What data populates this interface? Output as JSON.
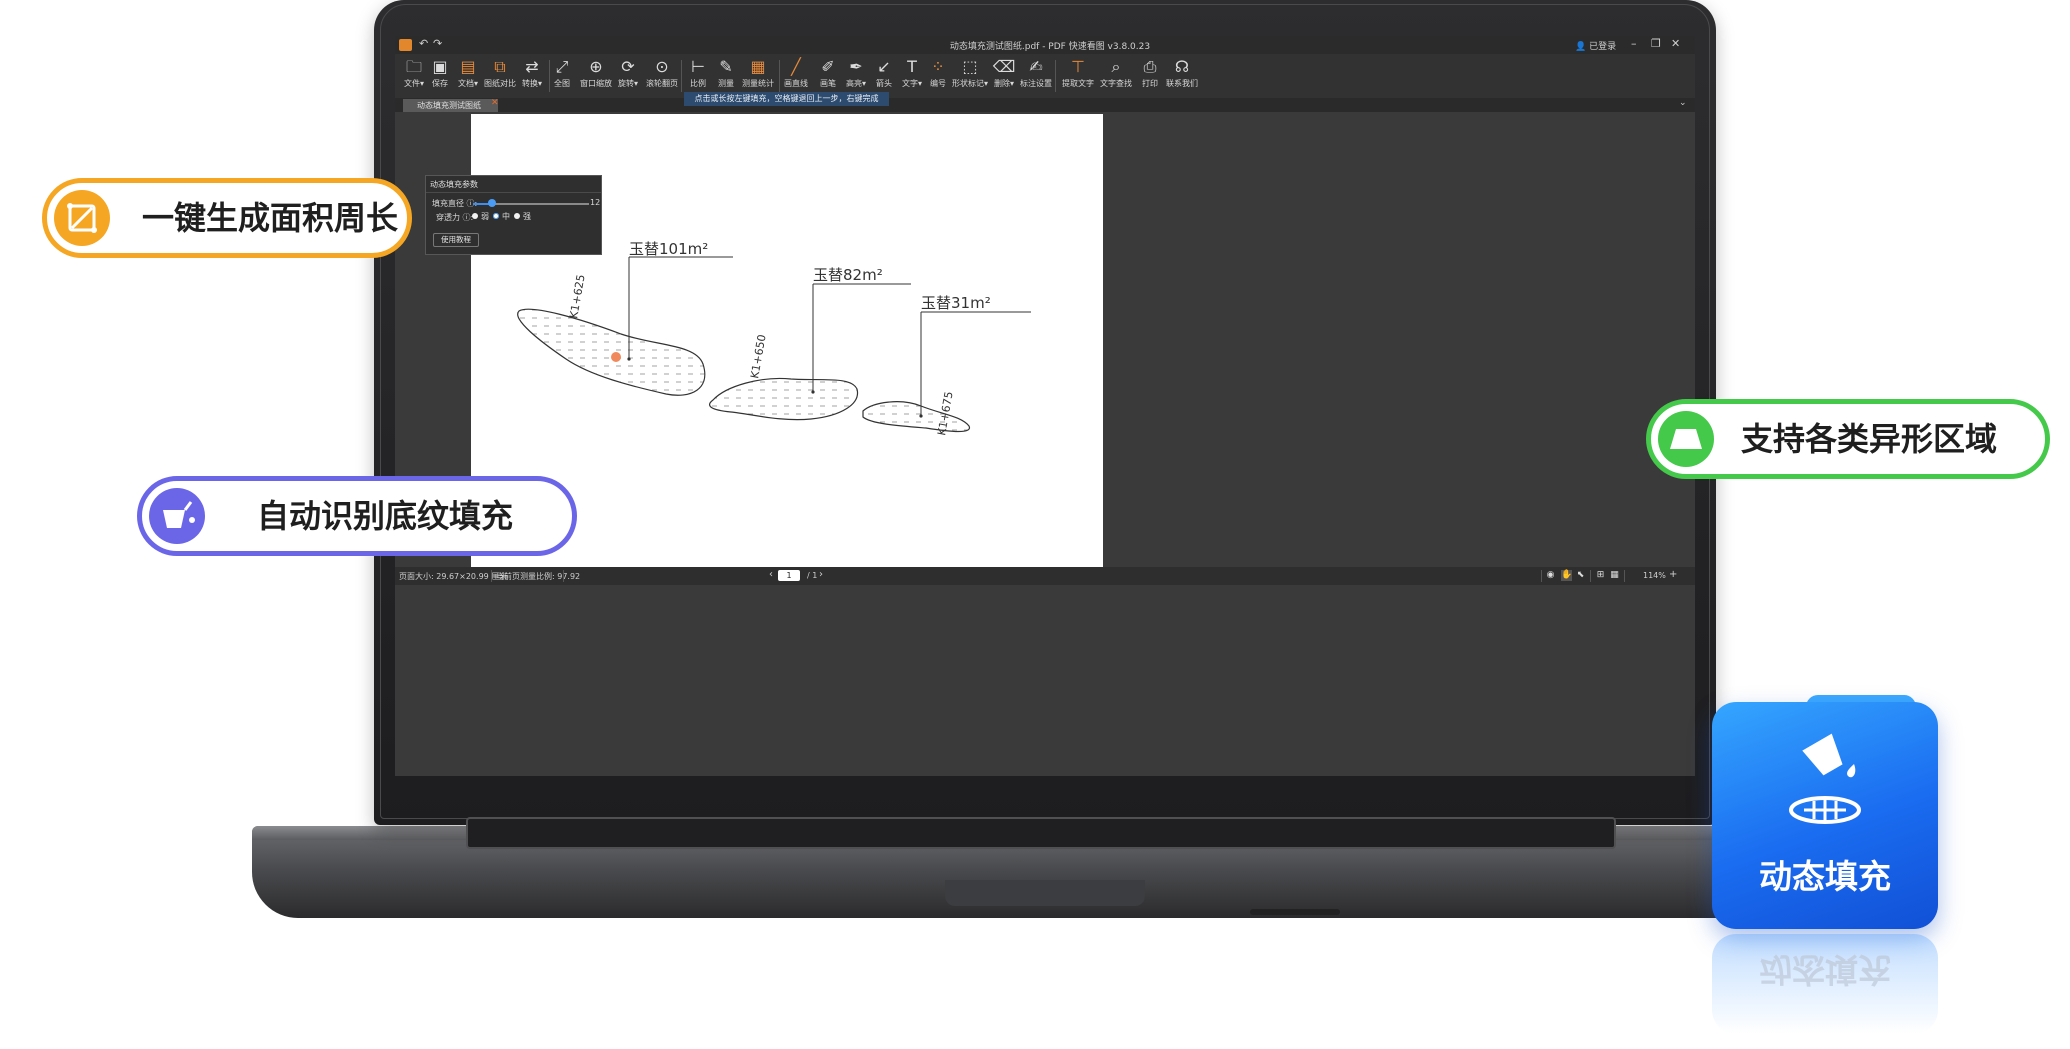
{
  "app": {
    "title": "动态填充测试图纸.pdf - PDF 快速看图 v3.8.0.23",
    "login": "已登录",
    "tab_name": "动态填充测试图纸",
    "hint": "点击或长按左键填充，空格键退回上一步，右键完成"
  },
  "toolbar": [
    {
      "label": "文件▾",
      "icon": "folder-icon"
    },
    {
      "label": "保存",
      "icon": "save-icon"
    },
    {
      "label": "文档▾",
      "icon": "document-icon"
    },
    {
      "label": "图纸对比",
      "icon": "compare-icon"
    },
    {
      "label": "转换▾",
      "icon": "convert-icon"
    },
    {
      "label": "全图",
      "icon": "fit-all-icon"
    },
    {
      "label": "窗口缩放",
      "icon": "window-zoom-icon"
    },
    {
      "label": "旋转▾",
      "icon": "rotate-icon"
    },
    {
      "label": "滚轮翻页",
      "icon": "mouse-wheel-icon"
    },
    {
      "label": "比例",
      "icon": "scale-icon"
    },
    {
      "label": "测量",
      "icon": "measure-icon"
    },
    {
      "label": "测量统计",
      "icon": "measure-stats-icon"
    },
    {
      "label": "画直线",
      "icon": "line-icon"
    },
    {
      "label": "画笔",
      "icon": "pen-icon"
    },
    {
      "label": "高亮▾",
      "icon": "highlight-icon"
    },
    {
      "label": "箭头",
      "icon": "arrow-icon"
    },
    {
      "label": "文字▾",
      "icon": "text-icon"
    },
    {
      "label": "编号",
      "icon": "numbering-icon"
    },
    {
      "label": "形状标记▾",
      "icon": "shape-mark-icon"
    },
    {
      "label": "删除▾",
      "icon": "eraser-icon"
    },
    {
      "label": "标注设置",
      "icon": "annotation-settings-icon"
    },
    {
      "label": "提取文字",
      "icon": "extract-text-icon"
    },
    {
      "label": "文字查找",
      "icon": "search-icon"
    },
    {
      "label": "打印",
      "icon": "print-icon"
    },
    {
      "label": "联系我们",
      "icon": "headset-icon"
    }
  ],
  "panel": {
    "title": "动态填充参数",
    "fill_diameter_label": "填充直径 ⓘ:",
    "fill_diameter_value": "12",
    "fill_diameter_fraction": 0.16,
    "penetration_label": "穿透力 ⓘ:",
    "options": [
      "弱",
      "中",
      "强"
    ],
    "selected": "中",
    "tutorial_button": "使用教程"
  },
  "drawing": {
    "labels": [
      {
        "name": "玉替",
        "area": "101m²"
      },
      {
        "name": "玉替",
        "area": "82m²"
      },
      {
        "name": "玉替",
        "area": "31m²"
      }
    ],
    "stakes": [
      "K1+625",
      "K1+650",
      "K1+675"
    ]
  },
  "status": {
    "page_size": "页面大小: 29.67×20.99 厘米",
    "scale": "当前页测量比例: 97.92",
    "page_current": "1",
    "page_total": "/ 1",
    "zoom": "114%"
  },
  "badges": {
    "area_perimeter": "一键生成面积周长",
    "auto_fill": "自动识别底纹填充",
    "irregular": "支持各类异形区域",
    "feature": "动态填充"
  },
  "colors": {
    "orange": "#f5a623",
    "purple": "#6b66e8",
    "green": "#45c94a",
    "blue": "#1a6cf0",
    "fill_point": "#f08a5d"
  }
}
